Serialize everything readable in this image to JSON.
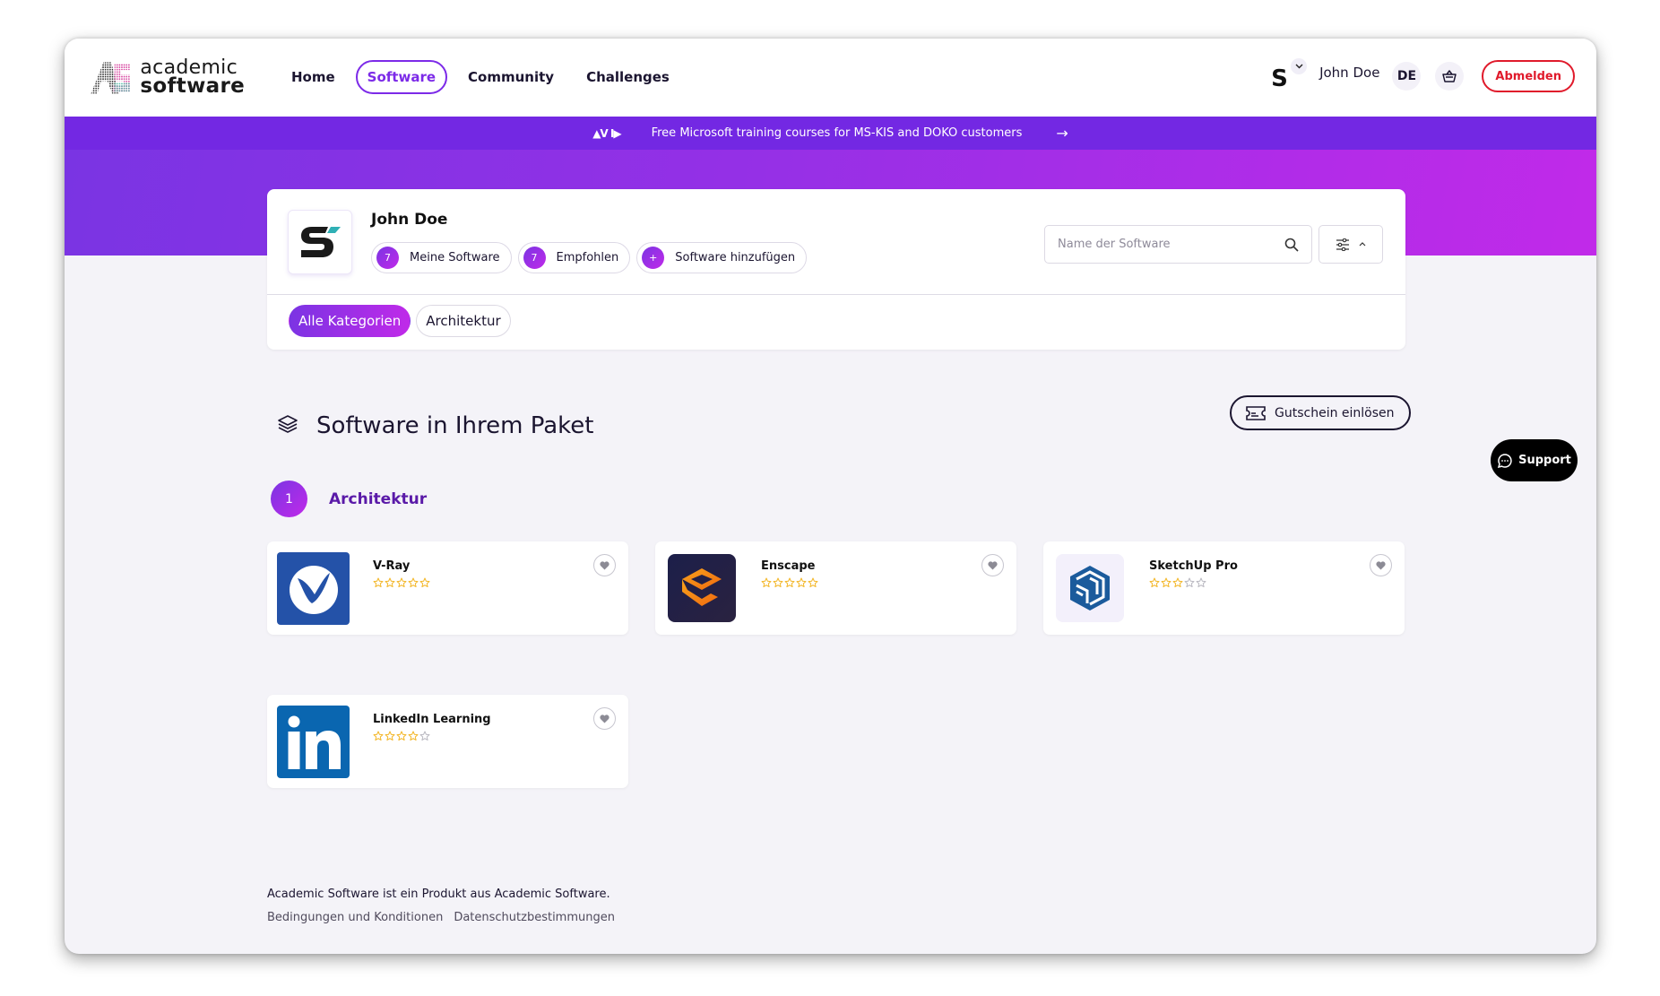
{
  "header": {
    "logo": {
      "line1": "academic",
      "line2": "software"
    },
    "nav": [
      {
        "label": "Home",
        "active": false
      },
      {
        "label": "Software",
        "active": true
      },
      {
        "label": "Community",
        "active": false
      },
      {
        "label": "Challenges",
        "active": false
      }
    ],
    "brand_switcher": {
      "letter": "S",
      "icon": "chevron-down-icon"
    },
    "user_name": "John Doe",
    "language": "DE",
    "cart_icon": "basket-icon",
    "logout_label": "Abmelden"
  },
  "banner": {
    "logo_text": "AVID",
    "text": "Free Microsoft training courses for MS-KIS and DOKO customers",
    "arrow_icon": "arrow-right-icon"
  },
  "profile": {
    "name": "John Doe",
    "chips": [
      {
        "badge": "7",
        "label": "Meine Software"
      },
      {
        "badge": "7",
        "label": "Empfohlen"
      },
      {
        "badge": "+",
        "label": "Software hinzufügen"
      }
    ],
    "search": {
      "placeholder": "Name der Software",
      "value": ""
    },
    "categories": [
      {
        "label": "Alle Kategorien",
        "active": true
      },
      {
        "label": "Architektur",
        "active": false
      }
    ]
  },
  "section": {
    "title": "Software in Ihrem Paket",
    "voucher_label": "Gutschein einlösen",
    "support_label": "Support",
    "category": {
      "number": "1",
      "label": "Architektur"
    }
  },
  "software": [
    {
      "name": "V-Ray",
      "rating": 5,
      "icon": "vray-logo"
    },
    {
      "name": "Enscape",
      "rating": 5,
      "icon": "enscape-logo"
    },
    {
      "name": "SketchUp Pro",
      "rating": 3,
      "icon": "sketchup-logo"
    },
    {
      "name": "LinkedIn Learning",
      "rating": 4,
      "icon": "linkedin-logo"
    }
  ],
  "footer": {
    "text": "Academic Software ist ein Produkt aus Academic Software.",
    "links": [
      "Bedingungen und Konditionen",
      "Datenschutzbestimmungen"
    ]
  },
  "colors": {
    "brand_purple": "#7c2ae8",
    "banner": "#7328e3",
    "hero_start": "#7a34e3",
    "hero_end": "#c12ae9",
    "logout_red": "#e01a2b",
    "star_gold": "#f3b626",
    "star_gray": "#b9b8c0"
  }
}
